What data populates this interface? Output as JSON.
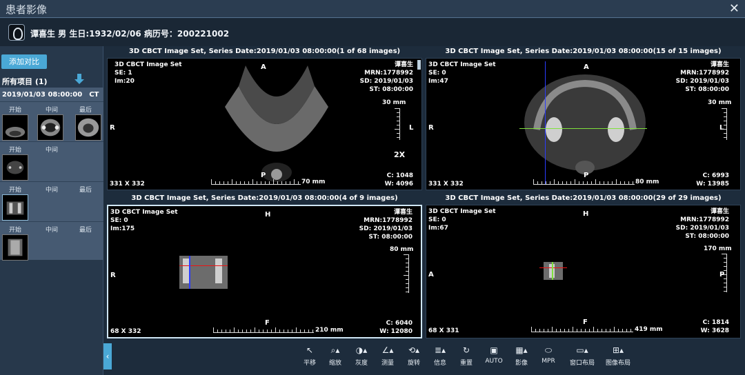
{
  "window": {
    "title": "患者影像",
    "close_icon": "✕"
  },
  "patient": {
    "info": "谭喜生 男 生日:1932/02/06 病历号：200221002"
  },
  "sidebar": {
    "compare_button": "添加对比",
    "all_items": "所有项目 (1)",
    "study": {
      "date": "2019/01/03 08:00:00",
      "modality": "CT"
    },
    "series_rows": [
      {
        "labels": [
          "开始",
          "中间",
          "最后"
        ]
      },
      {
        "labels": [
          "开始",
          "中间"
        ]
      },
      {
        "labels": [
          "开始",
          "中间",
          "最后"
        ]
      },
      {
        "labels": [
          "开始",
          "中间",
          "最后"
        ]
      }
    ],
    "collapse_icon": "‹"
  },
  "viewports": [
    {
      "title": "3D CBCT Image Set, Series Date:2019/01/03 08:00:00(1 of 68 images)",
      "tl": [
        "3D CBCT Image Set",
        "SE: 1",
        "Im:20"
      ],
      "tr": [
        "谭喜生",
        "MRN:1778992",
        "SD: 2019/01/03",
        "ST: 08:00:00"
      ],
      "top": "A",
      "bottom": "P",
      "left": "R",
      "right": "L",
      "scale_v": "30 mm",
      "scale_h": "70 mm",
      "zoom": "2X",
      "size": "331 X 332",
      "c": "C: 1048",
      "w": "W: 4096"
    },
    {
      "title": "3D CBCT Image Set, Series Date:2019/01/03 08:00:00(15 of 15 images)",
      "tl": [
        "3D CBCT Image Set",
        "SE: 0",
        "Im:47"
      ],
      "tr": [
        "谭喜生",
        "MRN:1778992",
        "SD: 2019/01/03",
        "ST: 08:00:00"
      ],
      "top": "A",
      "bottom": "P",
      "left": "R",
      "right": "L",
      "scale_v": "30 mm",
      "scale_h": "80 mm",
      "size": "331 X 332",
      "c": "C: 6993",
      "w": "W: 13985"
    },
    {
      "title": "3D CBCT Image Set, Series Date:2019/01/03 08:00:00(4 of 9 images)",
      "tl": [
        "3D CBCT Image Set",
        "SE: 0",
        "Im:175"
      ],
      "tr": [
        "谭喜生",
        "MRN:1778992",
        "SD: 2019/01/03",
        "ST: 08:00:00"
      ],
      "top": "H",
      "bottom": "F",
      "left": "R",
      "right": "",
      "scale_v": "80 mm",
      "scale_h": "210 mm",
      "size": "68 X 332",
      "c": "C: 6040",
      "w": "W: 12080"
    },
    {
      "title": "3D CBCT Image Set, Series Date:2019/01/03 08:00:00(29 of 29 images)",
      "tl": [
        "3D CBCT Image Set",
        "SE: 0",
        "Im:67"
      ],
      "tr": [
        "谭喜生",
        "MRN:1778992",
        "SD: 2019/01/03",
        "ST: 08:00:00"
      ],
      "top": "H",
      "bottom": "F",
      "left": "A",
      "right": "P",
      "scale_v": "170 mm",
      "scale_h": "419 mm",
      "size": "68 X 331",
      "c": "C: 1814",
      "w": "W: 3628"
    }
  ],
  "toolbar": [
    {
      "label": "平移",
      "icon": "↖",
      "icon_name": "pan"
    },
    {
      "label": "缩放",
      "icon": "⌕▴",
      "icon_name": "zoom"
    },
    {
      "label": "灰度",
      "icon": "◑▴",
      "icon_name": "contrast"
    },
    {
      "label": "测量",
      "icon": "∠▴",
      "icon_name": "measure"
    },
    {
      "label": "旋转",
      "icon": "⟲▴",
      "icon_name": "rotate"
    },
    {
      "label": "信息",
      "icon": "≣▴",
      "icon_name": "info"
    },
    {
      "label": "重置",
      "icon": "↻",
      "icon_name": "reset"
    },
    {
      "label": "AUTO",
      "icon": "▣",
      "icon_name": "auto"
    },
    {
      "label": "影像",
      "icon": "▦▴",
      "icon_name": "image"
    },
    {
      "label": "MPR",
      "icon": "⬭",
      "icon_name": "mpr"
    },
    {
      "label": "窗口布局",
      "icon": "▭▴",
      "icon_name": "window-layout"
    },
    {
      "label": "图像布局",
      "icon": "⊞▴",
      "icon_name": "image-layout"
    }
  ]
}
